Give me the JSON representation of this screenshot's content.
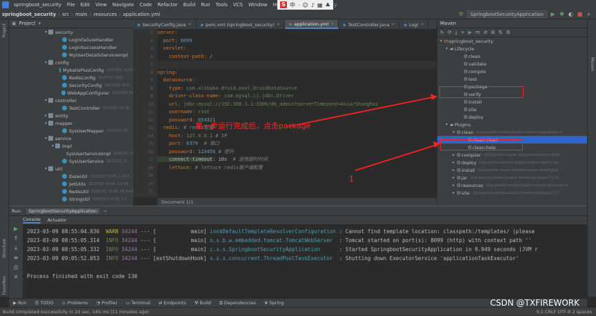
{
  "menubar": {
    "project": "springboot_security",
    "items": [
      "File",
      "Edit",
      "View",
      "Navigate",
      "Code",
      "Refactor",
      "Build",
      "Run",
      "Tools",
      "VCS",
      "Window",
      "Help"
    ],
    "window_title": "springboot_security"
  },
  "breadcrumb": [
    "springboot_security",
    "src",
    "main",
    "resources",
    "application.yml"
  ],
  "run_config": "SpringbootSecurityApplication",
  "project_panel": {
    "title": "Project",
    "tree": [
      {
        "indent": 5,
        "arrow": "▾",
        "icon": "folder",
        "label": "security",
        "meta": ""
      },
      {
        "indent": 7,
        "arrow": "",
        "icon": "cls",
        "label": "LoginFailureHandler",
        "meta": ""
      },
      {
        "indent": 7,
        "arrow": "",
        "icon": "cls",
        "label": "LoginSuccessHandler",
        "meta": ""
      },
      {
        "indent": 7,
        "arrow": "",
        "icon": "cls",
        "label": "MyUserDetailsServiceImpl",
        "meta": ""
      },
      {
        "indent": 5,
        "arrow": "▾",
        "icon": "folder",
        "label": "config",
        "meta": ""
      },
      {
        "indent": 7,
        "arrow": "",
        "icon": "cls",
        "label": "MybatisPlusConfig",
        "meta": "2023/3/1 15:30"
      },
      {
        "indent": 7,
        "arrow": "",
        "icon": "cls",
        "label": "RedisConfig",
        "meta": "2023/3/2 15:0"
      },
      {
        "indent": 7,
        "arrow": "",
        "icon": "cls",
        "label": "SecurityConfig",
        "meta": "2023/3/8 16:2"
      },
      {
        "indent": 7,
        "arrow": "",
        "icon": "cls",
        "label": "WebAppConfigurer",
        "meta": "2023/3/8 16"
      },
      {
        "indent": 5,
        "arrow": "▾",
        "icon": "folder",
        "label": "controller",
        "meta": ""
      },
      {
        "indent": 7,
        "arrow": "",
        "icon": "cls",
        "label": "TestController",
        "meta": "2023/3/3 16:08"
      },
      {
        "indent": 5,
        "arrow": "▸",
        "icon": "folder",
        "label": "entity",
        "meta": ""
      },
      {
        "indent": 5,
        "arrow": "▾",
        "icon": "folder",
        "label": "mapper",
        "meta": ""
      },
      {
        "indent": 7,
        "arrow": "",
        "icon": "cls",
        "label": "SysUserMapper",
        "meta": "2023/3/2 15:"
      },
      {
        "indent": 5,
        "arrow": "▾",
        "icon": "folder",
        "label": "service",
        "meta": ""
      },
      {
        "indent": 6,
        "arrow": "▾",
        "icon": "folder",
        "label": "impl",
        "meta": ""
      },
      {
        "indent": 8,
        "arrow": "",
        "icon": "cls",
        "label": "SysUserServiceImpl",
        "meta": "2023/3/2 15"
      },
      {
        "indent": 7,
        "arrow": "",
        "icon": "cls",
        "label": "SysUserService",
        "meta": "2023/3/2 15:"
      },
      {
        "indent": 5,
        "arrow": "▾",
        "icon": "folder",
        "label": "util",
        "meta": ""
      },
      {
        "indent": 7,
        "arrow": "",
        "icon": "cls",
        "label": "DateUtil",
        "meta": "2023/3/2 15:06, 1.19 K"
      },
      {
        "indent": 7,
        "arrow": "",
        "icon": "cls",
        "label": "JwtUtils",
        "meta": "2023/3/2 15:06, 2.5 kB"
      },
      {
        "indent": 7,
        "arrow": "",
        "icon": "cls",
        "label": "RedisUtil",
        "meta": "2023/3/2 15:06, 18.3 kB"
      },
      {
        "indent": 7,
        "arrow": "",
        "icon": "cls",
        "label": "StringUtil",
        "meta": "2023/3/2 15:06, 1.7"
      }
    ]
  },
  "editor_tabs": [
    {
      "label": "SecurityConfig.java",
      "active": false
    },
    {
      "label": "pom.xml (springboot_security)",
      "active": false
    },
    {
      "label": "application.yml",
      "active": true
    },
    {
      "label": "TestController.java",
      "active": false
    },
    {
      "label": "Logi",
      "active": false
    }
  ],
  "line_numbers": [
    "1",
    "2",
    "3",
    "4",
    "5",
    "6",
    "7",
    "8",
    "9",
    "10",
    "11",
    "12",
    "13",
    "14",
    "15",
    "16",
    "17",
    "18",
    "19",
    "20",
    "21"
  ],
  "code": {
    "l1": "server:",
    "l2k": "  port: ",
    "l2v": "8099",
    "l3": "  servlet:",
    "l4k": "    context-path: ",
    "l4v": "/",
    "l6": "spring:",
    "l7": "  datasource:",
    "l8k": "    type: ",
    "l8v": "com.alibaba.druid.pool.DruidDataSource",
    "l9k": "    driver-class-name: ",
    "l9v": "com.mysql.cj.jdbc.Driver",
    "l10k": "    url: ",
    "l10v": "jdbc:mysql://192.168.1.1:3306/db_admin?serverTimezone=Asia/Shanghai",
    "l11k": "    username: ",
    "l11v": "root",
    "l12k": "    password: ",
    "l12v": "654321",
    "l13k": "  redis: ",
    "l13c": "# redis配置",
    "l14k": "    host: ",
    "l14v": "127.0.0.1",
    "l14c": " # IP",
    "l15k": "    port: ",
    "l15v": "6379",
    "l15c": "  # 端口",
    "l16k": "    password: ",
    "l16v": "123456",
    "l16c": " # 密码",
    "l17k": "    connect-timeout",
    "l17v": ": 10s",
    "l17c": "  # 连接超时时间",
    "l18k": "    lettuce: ",
    "l18c": "# lettuce redis客户端配置"
  },
  "doc_status": "Document 1/1",
  "maven": {
    "title": "Maven",
    "root": "springboot_security",
    "lifecycle_label": "Lifecycle",
    "lifecycle": [
      "clean",
      "validate",
      "compile",
      "test",
      "package",
      "verify",
      "install",
      "site",
      "deploy"
    ],
    "plugins_label": "Plugins",
    "clean_plugin": "clean",
    "clean_plugin_meta": "(org.apache.maven.plugins:maven-clean-plugin:3",
    "clean_goals": [
      "clean:clean",
      "clean:help"
    ],
    "plugins": [
      {
        "name": "compiler",
        "meta": "(org.apache.maven.plugins:maven-compiler"
      },
      {
        "name": "deploy",
        "meta": "(org.apache.maven.plugins:maven-deploy-plu"
      },
      {
        "name": "install",
        "meta": "(org.apache.maven.plugins:maven-install-plug"
      },
      {
        "name": "jar",
        "meta": "(org.apache.maven.plugins:maven-jar-plugin:3.2.0)"
      },
      {
        "name": "resources",
        "meta": "(org.apache.maven.plugins:maven-resources-p"
      },
      {
        "name": "site",
        "meta": "(org.apache.maven.plugins:maven-site-plugin:3.9"
      }
    ]
  },
  "annotations": {
    "text1": "第一步运行完成后，点击package",
    "text2": "1",
    "color": "#ff2020"
  },
  "run_panel": {
    "label": "Run:",
    "config_tab": "SpringbootSecurityApplication",
    "tabs": [
      "Console",
      "Actuator"
    ],
    "logs": [
      {
        "ts": "2023-03-09 08:55:04.836",
        "level": "WARN",
        "pid": "34244",
        "sep": " --- [",
        "thread": "           main]",
        "cls": " ion$DefaultTemplateResolverConfiguration",
        "msg": " : Cannot find template location: classpath:/templates/ (please"
      },
      {
        "ts": "2023-03-09 08:55:05.314",
        "level": "INFO",
        "pid": "34244",
        "sep": " --- [",
        "thread": "           main]",
        "cls": " o.s.b.w.embedded.tomcat.TomcatWebServer",
        "msg": "  : Tomcat started on port(s): 8099 (http) with context path ''"
      },
      {
        "ts": "2023-03-09 08:55:05.332",
        "level": "INFO",
        "pid": "34244",
        "sep": " --- [",
        "thread": "           main]",
        "cls": " c.x.s.SpringbootSecurityApplication",
        "msg": "      : Started SpringbootSecurityApplication in 9.949 seconds (JVM r"
      },
      {
        "ts": "2023-03-09 09:05:52.053",
        "level": "INFO",
        "pid": "34244",
        "sep": " --- [",
        "thread": "extShutdownHook]",
        "cls": " o.s.s.concurrent.ThreadPoolTaskExecutor",
        "msg": "  : Shutting down ExecutorService 'applicationTaskExecutor'"
      }
    ],
    "exit_msg": "Process finished with exit code 130"
  },
  "bottom_tools": [
    "Run",
    "TODO",
    "Problems",
    "Profiler",
    "Terminal",
    "Endpoints",
    "Build",
    "Dependencies",
    "Spring"
  ],
  "status": {
    "left": "Build completed successfully in 10 sec, 145 ms (11 minutes ago)",
    "right": "5:1  CRLF  UTF-8  2 spaces"
  },
  "watermark": "CSDN @TXFIREWORK"
}
